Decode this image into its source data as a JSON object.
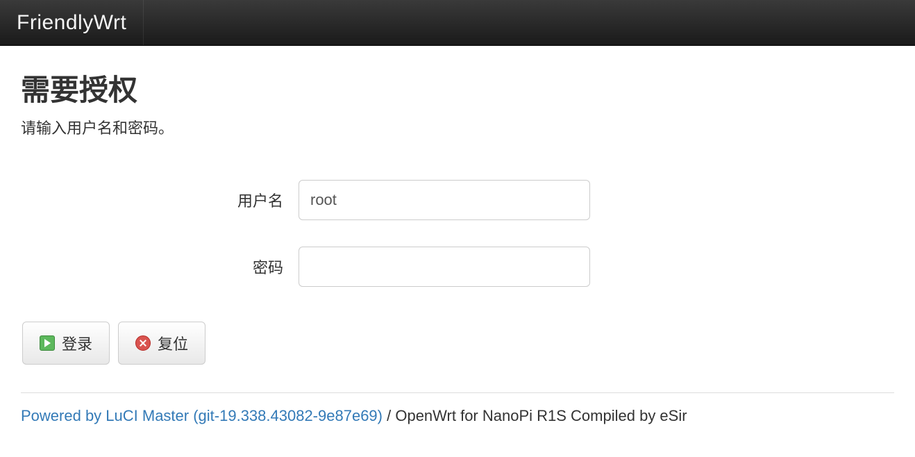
{
  "navbar": {
    "brand": "FriendlyWrt"
  },
  "page": {
    "title": "需要授权",
    "subtitle": "请输入用户名和密码。"
  },
  "form": {
    "username_label": "用户名",
    "username_value": "root",
    "password_label": "密码",
    "password_value": ""
  },
  "buttons": {
    "login": "登录",
    "reset": "复位"
  },
  "footer": {
    "link_text": "Powered by LuCI Master (git-19.338.43082-9e87e69)",
    "separator": " / ",
    "tail_text": "OpenWrt for NanoPi R1S Compiled by eSir"
  }
}
